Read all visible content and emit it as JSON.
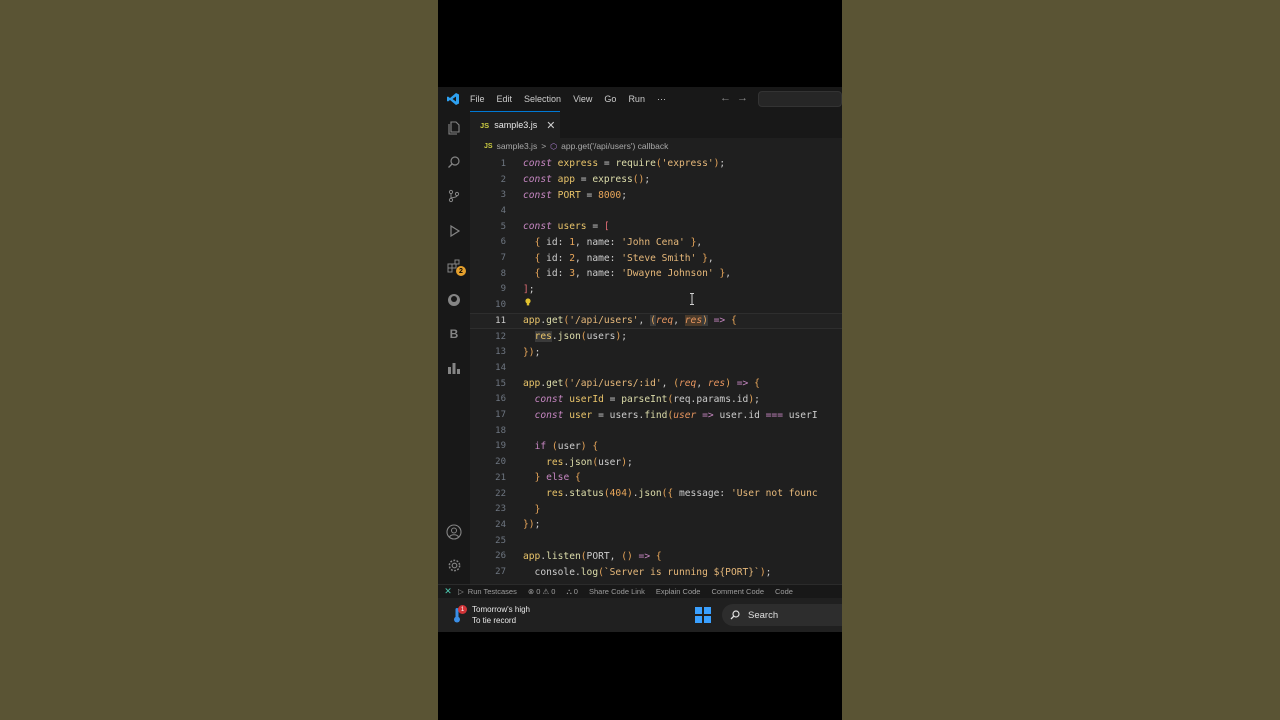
{
  "titlebar": {
    "menu": [
      "File",
      "Edit",
      "Selection",
      "View",
      "Go",
      "Run",
      "···"
    ]
  },
  "tab": {
    "icon": "JS",
    "filename": "sample3.js",
    "close": "✕"
  },
  "breadcrumb": {
    "icon": "JS",
    "file": "sample3.js",
    "separator": ">",
    "symbol": "app.get('/api/users') callback"
  },
  "editor": {
    "active_line": 11,
    "line_numbers": [
      "1",
      "2",
      "3",
      "4",
      "5",
      "6",
      "7",
      "8",
      "9",
      "10",
      "11",
      "12",
      "13",
      "14",
      "15",
      "16",
      "17",
      "18",
      "19",
      "20",
      "21",
      "22",
      "23",
      "24",
      "25",
      "26",
      "27"
    ]
  },
  "statusbar": {
    "items": [
      "Run Testcases",
      "⊗ 0 ⚠ 0",
      "⛬ 0",
      "Share Code Link",
      "Explain Code",
      "Comment Code",
      "Code"
    ]
  },
  "taskbar": {
    "weather_line1": "Tomorrow's high",
    "weather_line2": "To tie record",
    "weather_badge": "1",
    "search_label": "Search"
  },
  "colors": {
    "accent": "#0078d4",
    "editor_bg": "#1f1f1f",
    "keyword": "#c586c0",
    "string": "#e6b87a"
  }
}
